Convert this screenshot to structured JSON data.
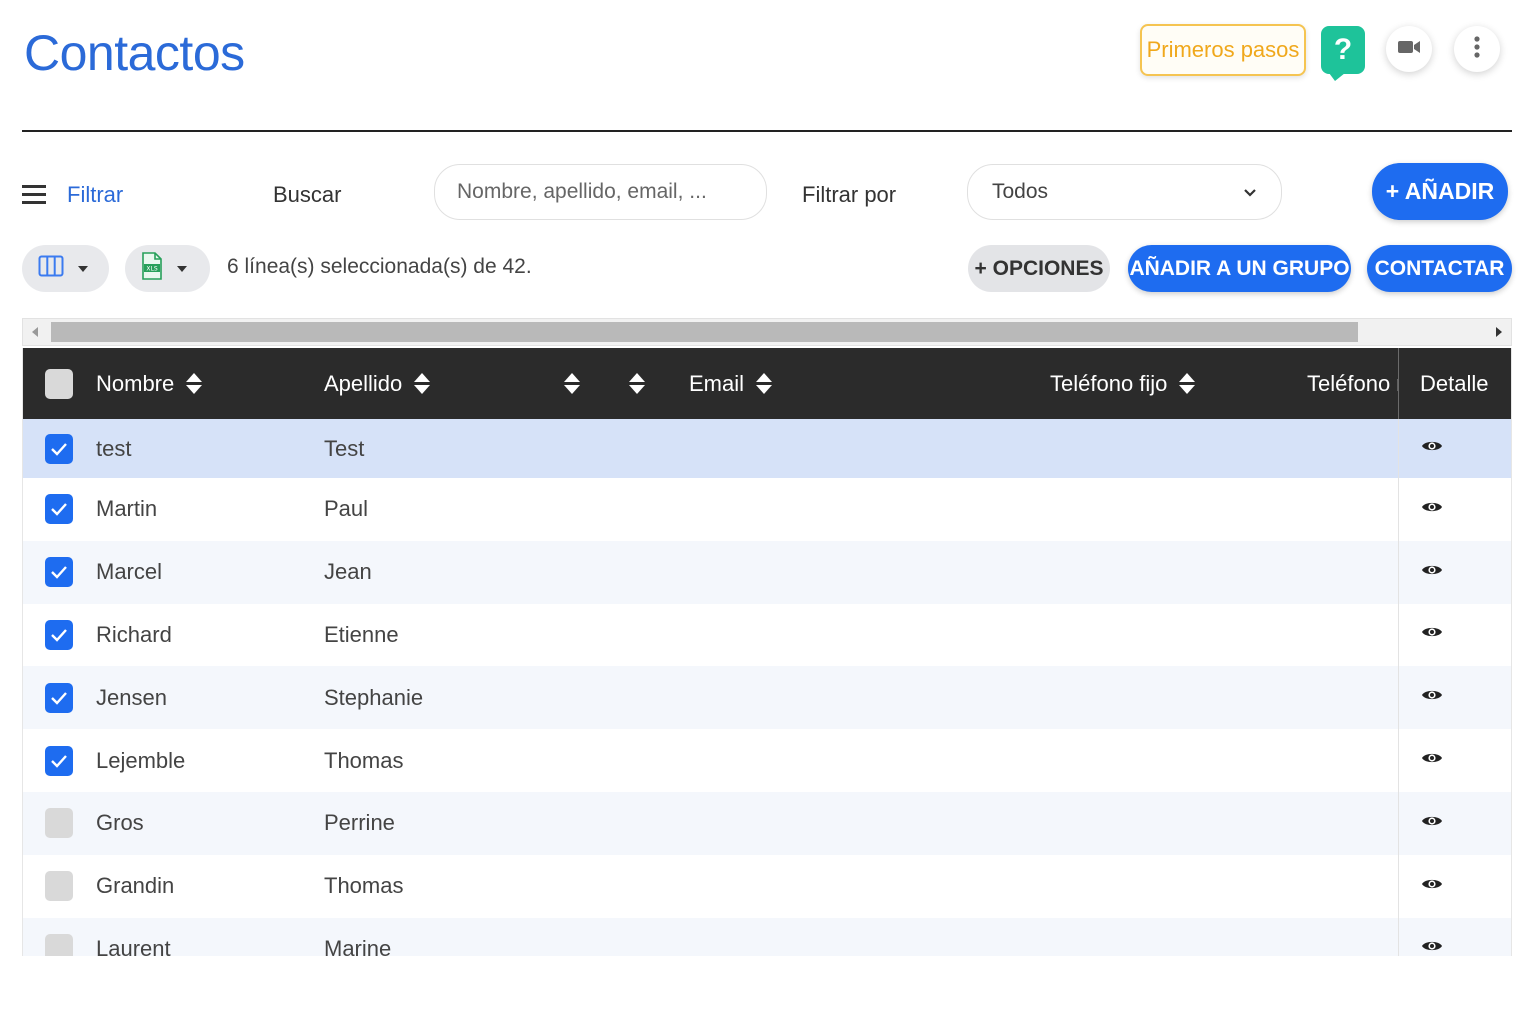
{
  "header": {
    "title": "Contactos",
    "primeros_pasos_label": "Primeros pasos",
    "help_label": "?",
    "video_icon": "video-camera-icon",
    "menu_icon": "more-vertical-icon"
  },
  "toolbar": {
    "filtrar_label": "Filtrar",
    "buscar_label": "Buscar",
    "search_placeholder": "Nombre, apellido, email, ...",
    "filtrar_por_label": "Filtrar por",
    "filter_selected": "Todos",
    "add_label": "+ AÑADIR"
  },
  "actions": {
    "selection_text": "6 línea(s) seleccionada(s) de 42.",
    "opciones_label": "+ OPCIONES",
    "grupo_label": "AÑADIR A UN GRUPO",
    "contactar_label": "CONTACTAR",
    "columns_icon": "columns-icon",
    "export_icon": "xls-file-icon"
  },
  "table": {
    "columns": {
      "nombre": "Nombre",
      "apellido": "Apellido",
      "email": "Email",
      "telefono_fijo": "Teléfono fijo",
      "telefono_movil": "Teléfono m",
      "detalle": "Detalle"
    },
    "rows": [
      {
        "nombre": "test",
        "apellido": "Test",
        "checked": true
      },
      {
        "nombre": "Martin",
        "apellido": "Paul",
        "checked": true
      },
      {
        "nombre": "Marcel",
        "apellido": "Jean",
        "checked": true
      },
      {
        "nombre": "Richard",
        "apellido": "Etienne",
        "checked": true
      },
      {
        "nombre": "Jensen",
        "apellido": "Stephanie",
        "checked": true
      },
      {
        "nombre": "Lejemble",
        "apellido": "Thomas",
        "checked": true
      },
      {
        "nombre": "Gros",
        "apellido": "Perrine",
        "checked": false
      },
      {
        "nombre": "Grandin",
        "apellido": "Thomas",
        "checked": false
      },
      {
        "nombre": "Laurent",
        "apellido": "Marine",
        "checked": false
      }
    ]
  },
  "colors": {
    "accent": "#1e6cf0",
    "title": "#2b6ad8",
    "header_bg": "#2b2b2b",
    "help": "#1ec39a",
    "primeros": "#f0a81c",
    "selected_row": "#d6e2f8"
  }
}
